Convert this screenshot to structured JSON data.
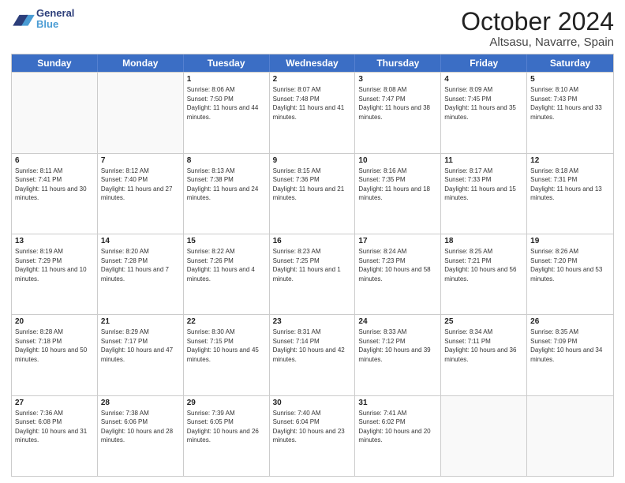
{
  "header": {
    "logo_general": "General",
    "logo_blue": "Blue",
    "month_title": "October 2024",
    "location": "Altsasu, Navarre, Spain"
  },
  "days_of_week": [
    "Sunday",
    "Monday",
    "Tuesday",
    "Wednesday",
    "Thursday",
    "Friday",
    "Saturday"
  ],
  "weeks": [
    [
      {
        "day": "",
        "info": ""
      },
      {
        "day": "",
        "info": ""
      },
      {
        "day": "1",
        "info": "Sunrise: 8:06 AM\nSunset: 7:50 PM\nDaylight: 11 hours and 44 minutes."
      },
      {
        "day": "2",
        "info": "Sunrise: 8:07 AM\nSunset: 7:48 PM\nDaylight: 11 hours and 41 minutes."
      },
      {
        "day": "3",
        "info": "Sunrise: 8:08 AM\nSunset: 7:47 PM\nDaylight: 11 hours and 38 minutes."
      },
      {
        "day": "4",
        "info": "Sunrise: 8:09 AM\nSunset: 7:45 PM\nDaylight: 11 hours and 35 minutes."
      },
      {
        "day": "5",
        "info": "Sunrise: 8:10 AM\nSunset: 7:43 PM\nDaylight: 11 hours and 33 minutes."
      }
    ],
    [
      {
        "day": "6",
        "info": "Sunrise: 8:11 AM\nSunset: 7:41 PM\nDaylight: 11 hours and 30 minutes."
      },
      {
        "day": "7",
        "info": "Sunrise: 8:12 AM\nSunset: 7:40 PM\nDaylight: 11 hours and 27 minutes."
      },
      {
        "day": "8",
        "info": "Sunrise: 8:13 AM\nSunset: 7:38 PM\nDaylight: 11 hours and 24 minutes."
      },
      {
        "day": "9",
        "info": "Sunrise: 8:15 AM\nSunset: 7:36 PM\nDaylight: 11 hours and 21 minutes."
      },
      {
        "day": "10",
        "info": "Sunrise: 8:16 AM\nSunset: 7:35 PM\nDaylight: 11 hours and 18 minutes."
      },
      {
        "day": "11",
        "info": "Sunrise: 8:17 AM\nSunset: 7:33 PM\nDaylight: 11 hours and 15 minutes."
      },
      {
        "day": "12",
        "info": "Sunrise: 8:18 AM\nSunset: 7:31 PM\nDaylight: 11 hours and 13 minutes."
      }
    ],
    [
      {
        "day": "13",
        "info": "Sunrise: 8:19 AM\nSunset: 7:29 PM\nDaylight: 11 hours and 10 minutes."
      },
      {
        "day": "14",
        "info": "Sunrise: 8:20 AM\nSunset: 7:28 PM\nDaylight: 11 hours and 7 minutes."
      },
      {
        "day": "15",
        "info": "Sunrise: 8:22 AM\nSunset: 7:26 PM\nDaylight: 11 hours and 4 minutes."
      },
      {
        "day": "16",
        "info": "Sunrise: 8:23 AM\nSunset: 7:25 PM\nDaylight: 11 hours and 1 minute."
      },
      {
        "day": "17",
        "info": "Sunrise: 8:24 AM\nSunset: 7:23 PM\nDaylight: 10 hours and 58 minutes."
      },
      {
        "day": "18",
        "info": "Sunrise: 8:25 AM\nSunset: 7:21 PM\nDaylight: 10 hours and 56 minutes."
      },
      {
        "day": "19",
        "info": "Sunrise: 8:26 AM\nSunset: 7:20 PM\nDaylight: 10 hours and 53 minutes."
      }
    ],
    [
      {
        "day": "20",
        "info": "Sunrise: 8:28 AM\nSunset: 7:18 PM\nDaylight: 10 hours and 50 minutes."
      },
      {
        "day": "21",
        "info": "Sunrise: 8:29 AM\nSunset: 7:17 PM\nDaylight: 10 hours and 47 minutes."
      },
      {
        "day": "22",
        "info": "Sunrise: 8:30 AM\nSunset: 7:15 PM\nDaylight: 10 hours and 45 minutes."
      },
      {
        "day": "23",
        "info": "Sunrise: 8:31 AM\nSunset: 7:14 PM\nDaylight: 10 hours and 42 minutes."
      },
      {
        "day": "24",
        "info": "Sunrise: 8:33 AM\nSunset: 7:12 PM\nDaylight: 10 hours and 39 minutes."
      },
      {
        "day": "25",
        "info": "Sunrise: 8:34 AM\nSunset: 7:11 PM\nDaylight: 10 hours and 36 minutes."
      },
      {
        "day": "26",
        "info": "Sunrise: 8:35 AM\nSunset: 7:09 PM\nDaylight: 10 hours and 34 minutes."
      }
    ],
    [
      {
        "day": "27",
        "info": "Sunrise: 7:36 AM\nSunset: 6:08 PM\nDaylight: 10 hours and 31 minutes."
      },
      {
        "day": "28",
        "info": "Sunrise: 7:38 AM\nSunset: 6:06 PM\nDaylight: 10 hours and 28 minutes."
      },
      {
        "day": "29",
        "info": "Sunrise: 7:39 AM\nSunset: 6:05 PM\nDaylight: 10 hours and 26 minutes."
      },
      {
        "day": "30",
        "info": "Sunrise: 7:40 AM\nSunset: 6:04 PM\nDaylight: 10 hours and 23 minutes."
      },
      {
        "day": "31",
        "info": "Sunrise: 7:41 AM\nSunset: 6:02 PM\nDaylight: 10 hours and 20 minutes."
      },
      {
        "day": "",
        "info": ""
      },
      {
        "day": "",
        "info": ""
      }
    ]
  ]
}
